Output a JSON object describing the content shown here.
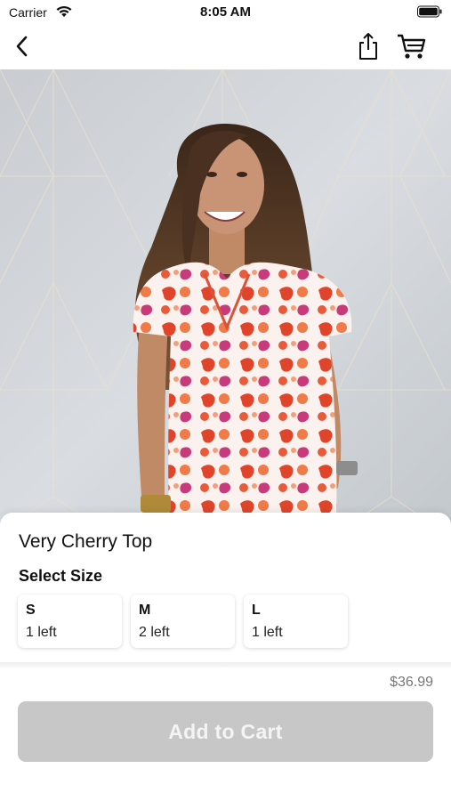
{
  "status_bar": {
    "carrier": "Carrier",
    "time": "8:05 AM"
  },
  "nav": {
    "back_icon": "chevron-left-icon",
    "share_icon": "share-icon",
    "cart_icon": "cart-icon"
  },
  "product": {
    "title": "Very Cherry Top",
    "select_size_label": "Select Size",
    "sizes": [
      {
        "size": "S",
        "stock": "1 left"
      },
      {
        "size": "M",
        "stock": "2 left"
      },
      {
        "size": "L",
        "stock": "1 left"
      }
    ],
    "price": "$36.99",
    "add_to_cart_label": "Add to Cart"
  },
  "colors": {
    "button_disabled": "#c7c7c7",
    "button_text": "#f4f4f4",
    "price_text": "#777777"
  }
}
